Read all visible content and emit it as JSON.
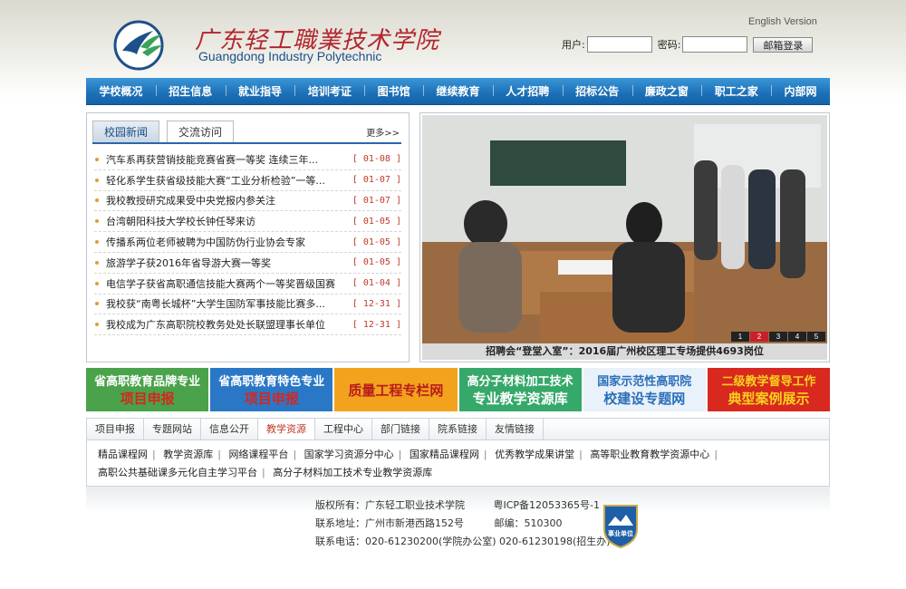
{
  "header": {
    "logo_cn": "广东轻工職業技术学院",
    "logo_en": "Guangdong Industry Polytechnic",
    "english_version": "English Version",
    "login": {
      "user_label": "用户:",
      "pass_label": "密码:",
      "button": "邮箱登录",
      "user_value": "",
      "pass_value": ""
    }
  },
  "nav": [
    "学校概况",
    "招生信息",
    "就业指导",
    "培训考证",
    "图书馆",
    "继续教育",
    "人才招聘",
    "招标公告",
    "廉政之窗",
    "职工之家",
    "内部网"
  ],
  "news": {
    "tabs": [
      "校园新闻",
      "交流访问"
    ],
    "more": "更多>>",
    "items": [
      {
        "title": "汽车系再获营销技能竞赛省赛一等奖 连续三年...",
        "date": "[ 01-08 ]"
      },
      {
        "title": "轻化系学生获省级技能大赛“工业分析检验”一等...",
        "date": "[ 01-07 ]"
      },
      {
        "title": "我校教授研究成果受中央党报内参关注",
        "date": "[ 01-07 ]"
      },
      {
        "title": "台湾朝阳科技大学校长钟任琴来访",
        "date": "[ 01-05 ]"
      },
      {
        "title": "传播系两位老师被聘为中国防伪行业协会专家",
        "date": "[ 01-05 ]"
      },
      {
        "title": "旅游学子获2016年省导游大赛一等奖",
        "date": "[ 01-05 ]"
      },
      {
        "title": "电信学子获省高职通信技能大赛两个一等奖晋级国赛",
        "date": "[ 01-04 ]"
      },
      {
        "title": "我校获“南粤长城杯”大学生国防军事技能比赛多...",
        "date": "[ 12-31 ]"
      },
      {
        "title": "我校成为广东高职院校教务处处长联盟理事长单位",
        "date": "[ 12-31 ]"
      }
    ]
  },
  "slideshow": {
    "caption": "招聘会“登堂入室”：2016届广州校区理工专场提供4693岗位",
    "pages": [
      "1",
      "2",
      "3",
      "4",
      "5"
    ],
    "current": "2"
  },
  "banners": [
    {
      "top": "省高职教育品牌专业",
      "bottom": "项目申报",
      "bg": "#4aa24a",
      "top_color": "#ffffff",
      "bottom_color": "#d7261e"
    },
    {
      "top": "省高职教育特色专业",
      "bottom": "项目申报",
      "bg": "#2a77c6",
      "top_color": "#ffffff",
      "bottom_color": "#d7261e"
    },
    {
      "top": "",
      "bottom": "质量工程专栏网",
      "bg": "#f2a21c",
      "top_color": "#ffffff",
      "bottom_color": "#b81c1c"
    },
    {
      "top": "高分子材料加工技术",
      "bottom": "专业教学资源库",
      "bg": "#36a86a",
      "top_color": "#ffffff",
      "bottom_color": "#ffffff"
    },
    {
      "top": "国家示范性高职院",
      "bottom": "校建设专题网",
      "bg": "#e9f1fa",
      "top_color": "#2a6fb8",
      "bottom_color": "#2a6fb8"
    },
    {
      "top": "二级教学督导工作",
      "bottom": "典型案例展示",
      "bg": "#d9281e",
      "top_color": "#f6d21d",
      "bottom_color": "#f6d21d"
    }
  ],
  "links": {
    "tabs": [
      "项目申报",
      "专题网站",
      "信息公开",
      "教学资源",
      "工程中心",
      "部门链接",
      "院系链接",
      "友情链接"
    ],
    "active_tab": "教学资源",
    "row1": [
      "精品课程网",
      "教学资源库",
      "网络课程平台",
      "国家学习资源分中心",
      "国家精品课程网",
      "优秀教学成果讲堂",
      "高等职业教育教学资源中心"
    ],
    "row2": [
      "高职公共基础课多元化自主学习平台",
      "高分子材料加工技术专业教学资源库"
    ]
  },
  "footer": {
    "copyright": "版权所有：广东轻工职业技术学院",
    "icp": "粤ICP备12053365号-1",
    "address": "联系地址：广州市新港西路152号",
    "postcode": "邮编：510300",
    "phone": "联系电话：020-61230200(学院办公室) 020-61230198(招生办)",
    "badge": "事业单位"
  }
}
